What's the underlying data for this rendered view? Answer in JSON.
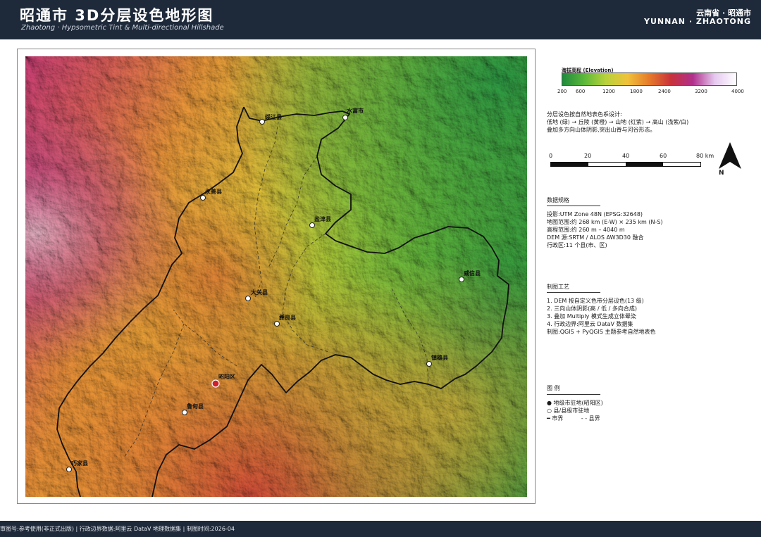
{
  "header": {
    "title": "昭通市 3D分层设色地形图",
    "subtitle": "Zhaotong · Hypsometric Tint & Multi-directional Hillshade",
    "region_cn": "云南省 · 昭通市",
    "region_en": "YUNNAN · ZHAOTONG"
  },
  "legend_ramp": {
    "title": "海拔高程 (Elevation)",
    "ticks": [
      "200",
      "600",
      "1200",
      "1800",
      "2400",
      "3200",
      "4000"
    ],
    "colors": [
      "#1e8a3c",
      "#5cb83a",
      "#b9d23a",
      "#f0c23a",
      "#e67a2a",
      "#c8323c",
      "#b0308c",
      "#e6c8f0",
      "#ffffff"
    ]
  },
  "description": {
    "line1": "分层设色按自然地表色系设计:",
    "line2": "低地 (绿) → 丘陵 (黄橙) → 山地 (红紫) → 高山 (浅紫/白)",
    "line3": "叠加多方向山体阴影,突出山脊与河谷形态。"
  },
  "scale_bar": {
    "labels": [
      "0",
      "20",
      "40",
      "60",
      "80 km"
    ],
    "north_label": "N"
  },
  "data_spec": {
    "title": "数据规格",
    "items": [
      "投影:UTM Zone 48N (EPSG:32648)",
      "地图范围:约 268 km (E-W) × 235 km (N-S)",
      "高程范围:约 260 m – 4040 m",
      "DEM 源:SRTM / ALOS AW3D30 融合",
      "行政区:11 个县(市、区)"
    ]
  },
  "process": {
    "title": "制图工艺",
    "items": [
      "1. DEM 按自定义色带分层设色(13 级)",
      "2. 三向山体阴影(高 / 低 / 多向合成)",
      "3. 叠加 Multiply 模式生成立体晕染",
      "4. 行政边界:阿里云 DataV 数据集",
      "制图:QGIS + PyQGIS  主题参考自然地表色"
    ]
  },
  "legend": {
    "title": "图 例",
    "item1": "● 地级市驻地(昭阳区)",
    "item2": "○ 县/县级市驻地",
    "item3": "━ 市界          - - 县界"
  },
  "places": [
    {
      "name": "绥江县",
      "type": "county"
    },
    {
      "name": "水富市",
      "type": "county"
    },
    {
      "name": "永善县",
      "type": "county"
    },
    {
      "name": "盐津县",
      "type": "county"
    },
    {
      "name": "威信县",
      "type": "county"
    },
    {
      "name": "大关县",
      "type": "county"
    },
    {
      "name": "彝良县",
      "type": "county"
    },
    {
      "name": "镇雄县",
      "type": "county"
    },
    {
      "name": "昭阳区",
      "type": "capital"
    },
    {
      "name": "鲁甸县",
      "type": "county"
    },
    {
      "name": "巧家县",
      "type": "county"
    }
  ],
  "footer": {
    "text": "审图号:参考使用(非正式出版)  |  行政边界数据:阿里云 DataV 地理数据集  |  制图时间:2026-04"
  }
}
